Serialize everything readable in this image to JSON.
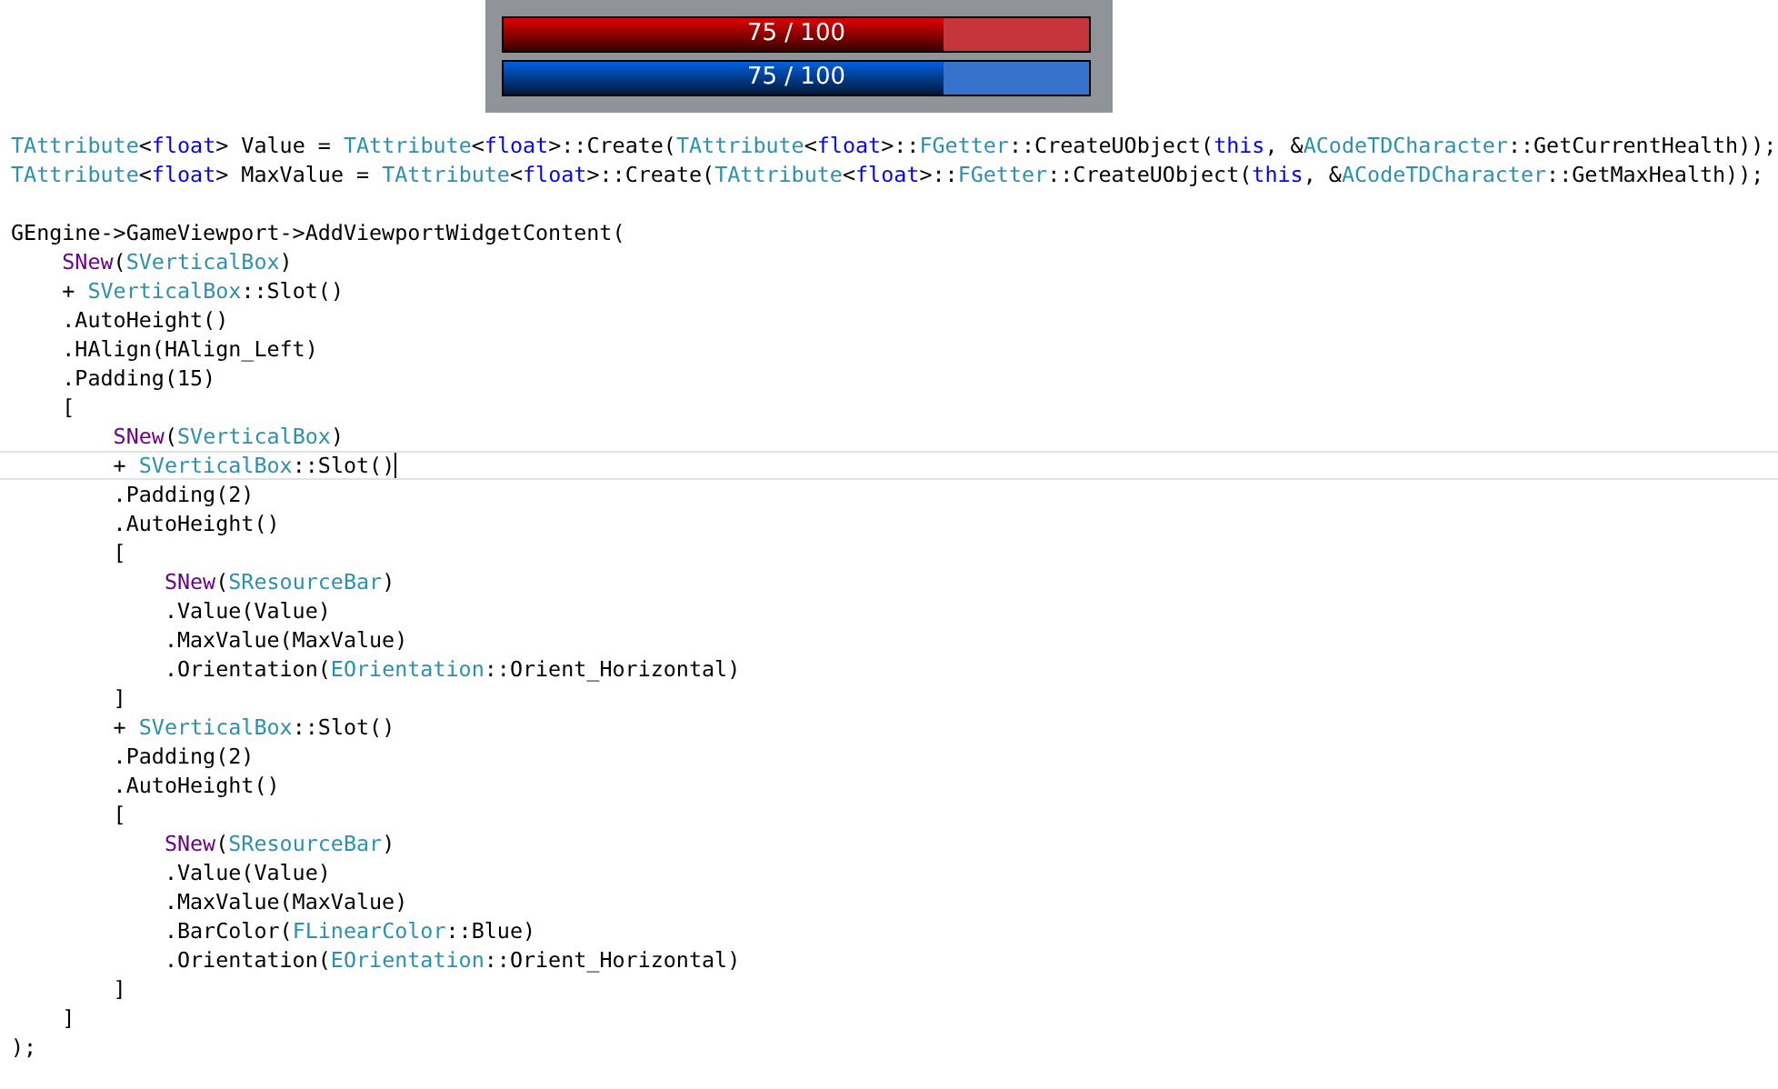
{
  "bars": [
    {
      "label": "75 / 100",
      "level": 0.75,
      "color": "#e00000"
    },
    {
      "label": "75 / 100",
      "level": 0.75,
      "color": "#0060e0"
    }
  ],
  "code_lines": [
    {
      "current": false,
      "tokens": [
        {
          "text": "TAttribute",
          "kind": "type"
        },
        {
          "text": "<",
          "kind": "plain"
        },
        {
          "text": "float",
          "kind": "keyword"
        },
        {
          "text": "> Value = ",
          "kind": "plain"
        },
        {
          "text": "TAttribute",
          "kind": "type"
        },
        {
          "text": "<",
          "kind": "plain"
        },
        {
          "text": "float",
          "kind": "keyword"
        },
        {
          "text": ">::Create(",
          "kind": "plain"
        },
        {
          "text": "TAttribute",
          "kind": "type"
        },
        {
          "text": "<",
          "kind": "plain"
        },
        {
          "text": "float",
          "kind": "keyword"
        },
        {
          "text": ">::",
          "kind": "plain"
        },
        {
          "text": "FGetter",
          "kind": "type"
        },
        {
          "text": "::CreateUObject(",
          "kind": "plain"
        },
        {
          "text": "this",
          "kind": "keyword"
        },
        {
          "text": ", &",
          "kind": "plain"
        },
        {
          "text": "ACodeTDCharacter",
          "kind": "type"
        },
        {
          "text": "::GetCurrentHealth));",
          "kind": "plain"
        }
      ]
    },
    {
      "current": false,
      "tokens": [
        {
          "text": "TAttribute",
          "kind": "type"
        },
        {
          "text": "<",
          "kind": "plain"
        },
        {
          "text": "float",
          "kind": "keyword"
        },
        {
          "text": "> MaxValue = ",
          "kind": "plain"
        },
        {
          "text": "TAttribute",
          "kind": "type"
        },
        {
          "text": "<",
          "kind": "plain"
        },
        {
          "text": "float",
          "kind": "keyword"
        },
        {
          "text": ">::Create(",
          "kind": "plain"
        },
        {
          "text": "TAttribute",
          "kind": "type"
        },
        {
          "text": "<",
          "kind": "plain"
        },
        {
          "text": "float",
          "kind": "keyword"
        },
        {
          "text": ">::",
          "kind": "plain"
        },
        {
          "text": "FGetter",
          "kind": "type"
        },
        {
          "text": "::CreateUObject(",
          "kind": "plain"
        },
        {
          "text": "this",
          "kind": "keyword"
        },
        {
          "text": ", &",
          "kind": "plain"
        },
        {
          "text": "ACodeTDCharacter",
          "kind": "type"
        },
        {
          "text": "::GetMaxHealth));",
          "kind": "plain"
        }
      ]
    },
    {
      "current": false
    },
    {
      "current": false,
      "tokens": [
        {
          "text": "GEngine->GameViewport->AddViewportWidgetContent(",
          "kind": "plain"
        }
      ]
    },
    {
      "current": false,
      "tokens": [
        {
          "text": "    SNew",
          "kind": "macro"
        },
        {
          "text": "(",
          "kind": "plain"
        },
        {
          "text": "SVerticalBox",
          "kind": "type"
        },
        {
          "text": ")",
          "kind": "plain"
        }
      ]
    },
    {
      "current": false,
      "tokens": [
        {
          "text": "    + ",
          "kind": "plain"
        },
        {
          "text": "SVerticalBox",
          "kind": "type"
        },
        {
          "text": "::Slot()",
          "kind": "plain"
        }
      ]
    },
    {
      "current": false,
      "tokens": [
        {
          "text": "    .AutoHeight()",
          "kind": "plain"
        }
      ]
    },
    {
      "current": false,
      "tokens": [
        {
          "text": "    .HAlign(HAlign_Left)",
          "kind": "plain"
        }
      ]
    },
    {
      "current": false,
      "tokens": [
        {
          "text": "    .Padding(15)",
          "kind": "plain"
        }
      ]
    },
    {
      "current": false,
      "tokens": [
        {
          "text": "    [",
          "kind": "plain"
        }
      ]
    },
    {
      "current": false,
      "tokens": [
        {
          "text": "        SNew",
          "kind": "macro"
        },
        {
          "text": "(",
          "kind": "plain"
        },
        {
          "text": "SVerticalBox",
          "kind": "type"
        },
        {
          "text": ")",
          "kind": "plain"
        }
      ]
    },
    {
      "current": true,
      "tokens": [
        {
          "text": "        + ",
          "kind": "plain"
        },
        {
          "text": "SVerticalBox",
          "kind": "type"
        },
        {
          "text": "::Slot()",
          "kind": "plain"
        }
      ]
    },
    {
      "current": false,
      "tokens": [
        {
          "text": "        .Padding(2)",
          "kind": "plain"
        }
      ]
    },
    {
      "current": false,
      "tokens": [
        {
          "text": "        .AutoHeight()",
          "kind": "plain"
        }
      ]
    },
    {
      "current": false,
      "tokens": [
        {
          "text": "        [",
          "kind": "plain"
        }
      ]
    },
    {
      "current": false,
      "tokens": [
        {
          "text": "            SNew",
          "kind": "macro"
        },
        {
          "text": "(",
          "kind": "plain"
        },
        {
          "text": "SResourceBar",
          "kind": "type"
        },
        {
          "text": ")",
          "kind": "plain"
        }
      ]
    },
    {
      "current": false,
      "tokens": [
        {
          "text": "            .Value(Value)",
          "kind": "plain"
        }
      ]
    },
    {
      "current": false,
      "tokens": [
        {
          "text": "            .MaxValue(MaxValue)",
          "kind": "plain"
        }
      ]
    },
    {
      "current": false,
      "tokens": [
        {
          "text": "            .Orientation(",
          "kind": "plain"
        },
        {
          "text": "EOrientation",
          "kind": "type"
        },
        {
          "text": "::Orient_Horizontal)",
          "kind": "plain"
        }
      ]
    },
    {
      "current": false,
      "tokens": [
        {
          "text": "        ]",
          "kind": "plain"
        }
      ]
    },
    {
      "current": false,
      "tokens": [
        {
          "text": "        + ",
          "kind": "plain"
        },
        {
          "text": "SVerticalBox",
          "kind": "type"
        },
        {
          "text": "::Slot()",
          "kind": "plain"
        }
      ]
    },
    {
      "current": false,
      "tokens": [
        {
          "text": "        .Padding(2)",
          "kind": "plain"
        }
      ]
    },
    {
      "current": false,
      "tokens": [
        {
          "text": "        .AutoHeight()",
          "kind": "plain"
        }
      ]
    },
    {
      "current": false,
      "tokens": [
        {
          "text": "        [",
          "kind": "plain"
        }
      ]
    },
    {
      "current": false,
      "tokens": [
        {
          "text": "            SNew",
          "kind": "macro"
        },
        {
          "text": "(",
          "kind": "plain"
        },
        {
          "text": "SResourceBar",
          "kind": "type"
        },
        {
          "text": ")",
          "kind": "plain"
        }
      ]
    },
    {
      "current": false,
      "tokens": [
        {
          "text": "            .Value(Value)",
          "kind": "plain"
        }
      ]
    },
    {
      "current": false,
      "tokens": [
        {
          "text": "            .MaxValue(MaxValue)",
          "kind": "plain"
        }
      ]
    },
    {
      "current": false,
      "tokens": [
        {
          "text": "            .BarColor(",
          "kind": "plain"
        },
        {
          "text": "FLinearColor",
          "kind": "type"
        },
        {
          "text": "::Blue)",
          "kind": "plain"
        }
      ]
    },
    {
      "current": false,
      "tokens": [
        {
          "text": "            .Orientation(",
          "kind": "plain"
        },
        {
          "text": "EOrientation",
          "kind": "type"
        },
        {
          "text": "::Orient_Horizontal)",
          "kind": "plain"
        }
      ]
    },
    {
      "current": false,
      "tokens": [
        {
          "text": "        ]",
          "kind": "plain"
        }
      ]
    },
    {
      "current": false,
      "tokens": [
        {
          "text": "    ]",
          "kind": "plain"
        }
      ]
    },
    {
      "current": false,
      "tokens": [
        {
          "text": ");",
          "kind": "plain"
        }
      ]
    }
  ]
}
